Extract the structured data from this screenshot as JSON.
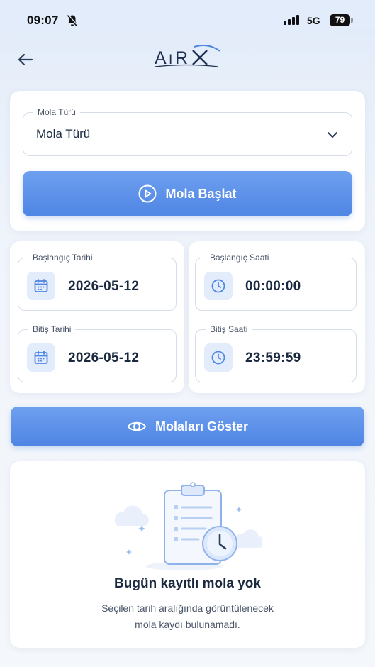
{
  "status_bar": {
    "time": "09:07",
    "network": "5G",
    "battery": "79"
  },
  "header": {
    "logo_text": "AIRX"
  },
  "break_type": {
    "label": "Mola Türü",
    "value": "Mola Türü"
  },
  "start_button": {
    "label": "Mola Başlat"
  },
  "dates": {
    "start_date_label": "Başlangıç Tarihi",
    "start_date_value": "2026-05-12",
    "end_date_label": "Bitiş Tarihi",
    "end_date_value": "2026-05-12"
  },
  "times": {
    "start_time_label": "Başlangıç Saati",
    "start_time_value": "00:00:00",
    "end_time_label": "Bitiş Saati",
    "end_time_value": "23:59:59"
  },
  "show_button": {
    "label": "Molaları Göster"
  },
  "empty_state": {
    "title": "Bugün kayıtlı mola yok",
    "description_line1": "Seçilen tarih aralığında görüntülenecek",
    "description_line2": "mola kaydı bulunamadı."
  },
  "colors": {
    "accent": "#5a8fe8",
    "text_dark": "#1b2940",
    "icon_bg": "#e3ecfb"
  }
}
